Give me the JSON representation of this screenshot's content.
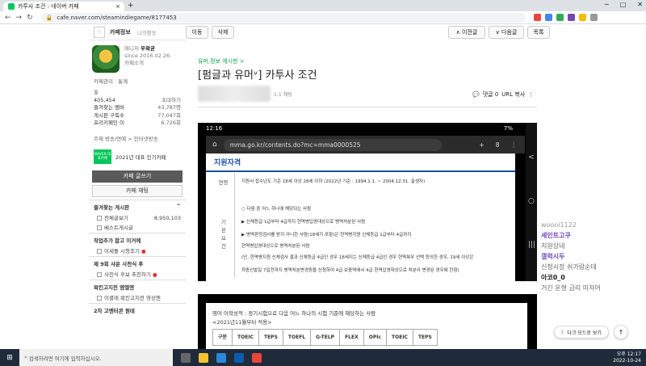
{
  "browser": {
    "tab_title": "카투사 조건 : 네이버 카페",
    "url": "cafe.naver.com/steamindiegame/8177453",
    "tab_close": "×",
    "new_tab": "+",
    "nav_back": "←",
    "nav_forward": "→",
    "nav_reload": "↻",
    "win_min": "─",
    "win_max": "□",
    "win_close": "✕"
  },
  "sidebar": {
    "tab_cafe_info": "카페정보",
    "tab_my_activity": "나의활동",
    "manager_label": "매니저",
    "manager_name": "우왁굳",
    "since": "since 2016.02.26.",
    "cafe_intro": "카페소개",
    "link_manage": "카페관리",
    "link_stats": "통계",
    "grade": "숲",
    "member_count": "405,454",
    "invite": "초대하기",
    "stat_rows": [
      {
        "label": "즐겨찾는 멤버",
        "value": "43,787명"
      },
      {
        "label": "게시판 구독수",
        "value": "77,047회"
      },
      {
        "label": "프리키페인 이",
        "value": "6,726회"
      }
    ],
    "rank_line": "주제 방송/연예 > 인터넷방송",
    "badge_logo": "NAVER 대표카페",
    "badge_text": "2021년 대표 인기카페",
    "write_button": "카페 글쓰기",
    "chat_button": "카페 채팅",
    "fav_section": "즐겨찾는 게시판",
    "fav_toggle": "^",
    "items": [
      {
        "label": "전체글보기",
        "value": "8,950,103"
      },
      {
        "label": "베스트게시글",
        "value": ""
      }
    ],
    "section2": "작업추가 합고 이거에",
    "item2": "이세돌 시청조기",
    "section3": "제 9회 샤운 사천식 후",
    "item3": "사천식 후보 추천하기",
    "section4": "왁킨고지전 엠엘엔",
    "item4": "이클래 왁킨고지전 영상엔",
    "section5": "2차 고멘터콘 뭔데"
  },
  "toolbar": {
    "move": "이동",
    "delete": "삭제",
    "prev": "∧ 이전글",
    "next": "∨ 다음글",
    "list": "목록"
  },
  "post": {
    "board": "유머,정보 게시판 >",
    "title": "[펌글과 유머ᵛ] 카투사 조건",
    "chat_label": "1:1 채팅",
    "comments": "댓글 0",
    "url_copy": "URL 복사"
  },
  "phone": {
    "time": "12:16",
    "battery": "7%",
    "url": "mma.go.kr/contents.do?mc=mma0000525",
    "tab_count": "8",
    "heading": "지원자격",
    "col_age": "연령",
    "col_basic": "기본요건",
    "age_line": "지원서 접수년도 기준 18세 이상 28세 이하 (2022년 기준 : 1994.1.1. ~ 2004.12.31. 출생자)",
    "rows": [
      "○ 다음 중 어느 하나에 해당되는 사람",
      "▶ 신체등급 1급부터 4급까지 현역병입영대상으로 병역처분된 사람",
      "▶ 병역판정검사를 받지 아니한 사람(18세가 포함)은 현역병지원 신체등급 1급부터 4급까지",
      "현역병입영대상으로 병역처분된 사람",
      "(단, 현역병지원 신체검사 결과 신체등급 4급인 경우 18세지는 신체등급 4급인 경우 현역복무 선택 등의한 경우, 19세 이상은",
      "최종선발일 7일전까지 병역처분변경원을 신청하여 4급 보충역에서 4급 현역입영대상으로 처분이 변경된 경우에 한함)"
    ],
    "back_label": "<",
    "home_label": "○",
    "menu_label": "|||"
  },
  "image2": {
    "line1": "영어 어학성적 : 정기시험으로 다음 어느 하나의 시험 기준에 해당하는 사람",
    "line2": "<2021년11월부터 적용>",
    "headers": [
      "구분",
      "TOEIC",
      "TEPS",
      "TOEFL",
      "G-TELP",
      "FLEX",
      "OPIc",
      "TOEIC",
      "TEPS"
    ]
  },
  "chat": {
    "m0_name": "woooi1122",
    "m1_name": "세인트고쿠",
    "m1_text": "지원상네",
    "m2_name": "갤럭시두",
    "m2_text": "신청시장 쉬가랑순데",
    "m3_name": "아코0_0",
    "m3_text": "거긴 운형 금리 미쳐어"
  },
  "darkmode_label": "다크 모드로 보기",
  "totop_label": "↑",
  "taskbar": {
    "search_placeholder": "검색하려면 여기에 입력하십시오.",
    "time": "오후 12:17",
    "date": "2022-10-24"
  },
  "colors": {
    "accent": "#03c75a",
    "chat_name": "#7048b6"
  }
}
